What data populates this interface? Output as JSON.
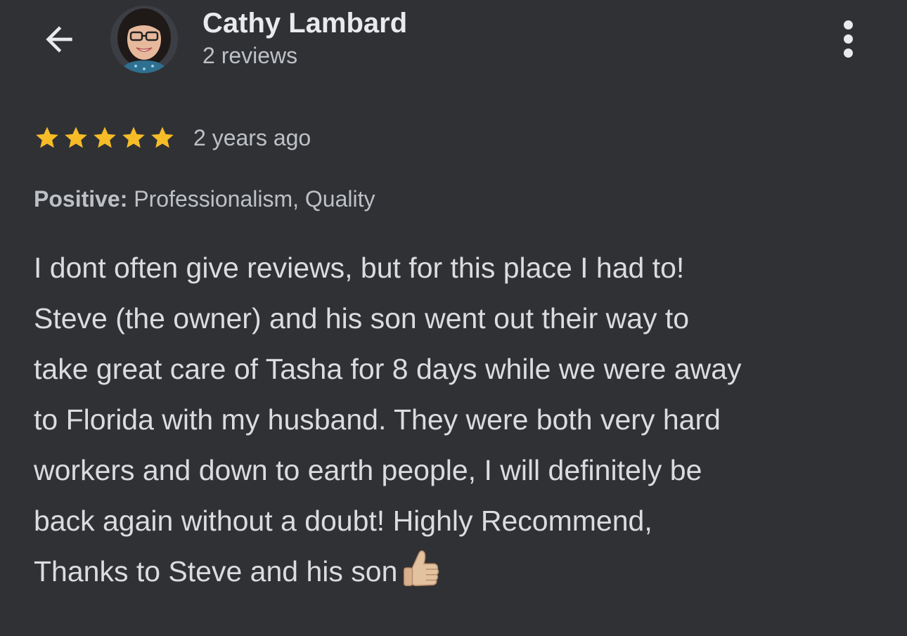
{
  "header": {
    "reviewer_name": "Cathy Lambard",
    "review_count": "2 reviews"
  },
  "review": {
    "rating": 5,
    "rating_max": 5,
    "date": "2 years ago",
    "attributes_label": "Positive:",
    "attributes_value": "Professionalism, Quality",
    "lines": [
      "I dont often give reviews, but for this place I had to!",
      "Steve (the owner) and his son went out their way to",
      "take great care of Tasha for 8 days while we were away",
      "to Florida with my husband. They were both very hard",
      "workers and down to earth people, I will definitely be",
      "back again without a doubt! Highly Recommend,",
      "Thanks to Steve and his son"
    ],
    "trailing_emoji": "thumbs-up-icon"
  },
  "icons": {
    "back": "arrow-left-icon",
    "more": "more-vertical-icon",
    "star": "star-icon"
  },
  "colors": {
    "background": "#303134",
    "star": "#f5bc28",
    "text_primary": "#e8eaed",
    "text_secondary": "#bdc1c6"
  }
}
